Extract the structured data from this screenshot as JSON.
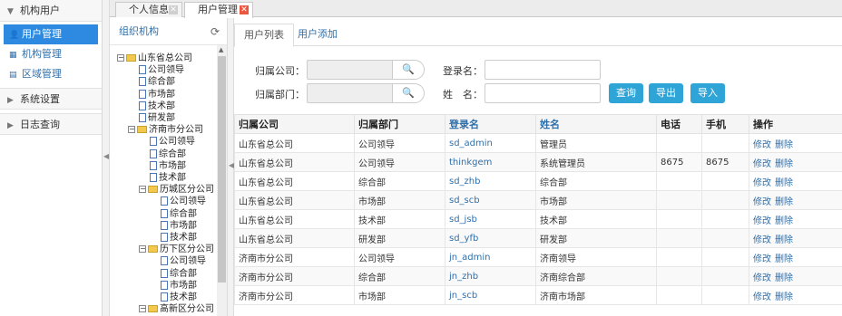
{
  "nav": {
    "group1": "机构用户",
    "items": [
      "用户管理",
      "机构管理",
      "区域管理"
    ],
    "group2": "系统设置",
    "group3": "日志查询"
  },
  "tabs": [
    {
      "label": "个人信息"
    },
    {
      "label": "用户管理"
    }
  ],
  "tree": {
    "title": "组织机构",
    "nodes": [
      "山东省总公司",
      "公司领导",
      "综合部",
      "市场部",
      "技术部",
      "研发部",
      "济南市分公司",
      "公司领导",
      "综合部",
      "市场部",
      "技术部",
      "历城区分公司",
      "公司领导",
      "综合部",
      "市场部",
      "技术部",
      "历下区分公司",
      "公司领导",
      "综合部",
      "市场部",
      "技术部",
      "高新区分公司"
    ]
  },
  "subtabs": [
    "用户列表",
    "用户添加"
  ],
  "search": {
    "company_label": "归属公司：",
    "dept_label": "归属部门：",
    "login_label": "登录名：",
    "name_label": "姓　名：",
    "query": "查询",
    "export": "导出",
    "import": "导入"
  },
  "table": {
    "headers": [
      "归属公司",
      "归属部门",
      "登录名",
      "姓名",
      "电话",
      "手机",
      "操作"
    ],
    "edit": "修改",
    "del": "删除",
    "rows": [
      [
        "山东省总公司",
        "公司领导",
        "sd_admin",
        "管理员",
        "",
        ""
      ],
      [
        "山东省总公司",
        "公司领导",
        "thinkgem",
        "系统管理员",
        "8675",
        "8675"
      ],
      [
        "山东省总公司",
        "综合部",
        "sd_zhb",
        "综合部",
        "",
        ""
      ],
      [
        "山东省总公司",
        "市场部",
        "sd_scb",
        "市场部",
        "",
        ""
      ],
      [
        "山东省总公司",
        "技术部",
        "sd_jsb",
        "技术部",
        "",
        ""
      ],
      [
        "山东省总公司",
        "研发部",
        "sd_yfb",
        "研发部",
        "",
        ""
      ],
      [
        "济南市分公司",
        "公司领导",
        "jn_admin",
        "济南领导",
        "",
        ""
      ],
      [
        "济南市分公司",
        "综合部",
        "jn_zhb",
        "济南综合部",
        "",
        ""
      ],
      [
        "济南市分公司",
        "市场部",
        "jn_scb",
        "济南市场部",
        "",
        ""
      ]
    ]
  }
}
